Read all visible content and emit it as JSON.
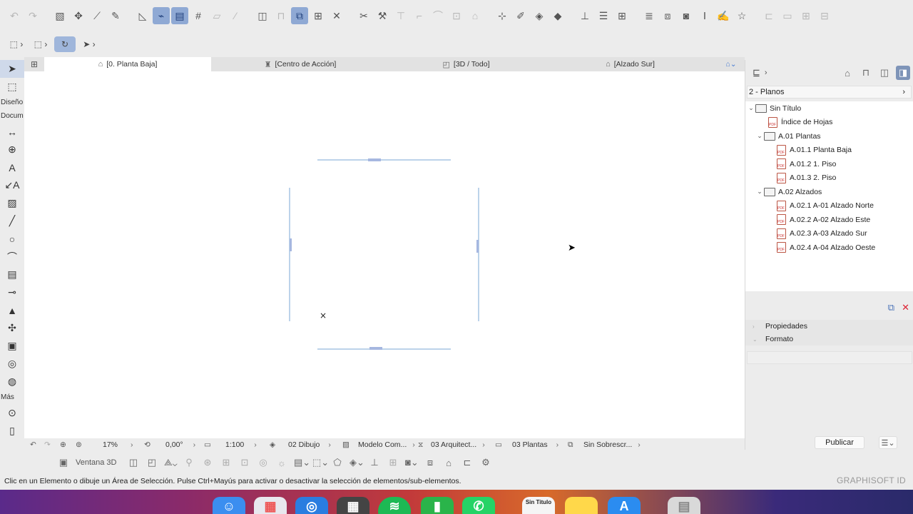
{
  "toolbar": {
    "icons": [
      "undo-icon",
      "redo-icon",
      "pick-up-icon",
      "inject-icon",
      "eyedropper-icon",
      "pencil-icon",
      "ruler-icon",
      "snap-guides-icon",
      "grid-snap-icon",
      "hash-grid-icon",
      "surface-icon",
      "paint-icon",
      "layers-box-icon",
      "lock-icon",
      "trace-icon",
      "renovation-icon",
      "dimension-icon",
      "cross-icon",
      "scissors-icon",
      "hammer-icon",
      "elevate-icon",
      "corner-icon",
      "arc-icon",
      "crop-icon",
      "roof-icon",
      "explode-icon",
      "brush-icon",
      "fill-icon",
      "3d-shape-icon",
      "stair-icon",
      "rail-icon",
      "fence-icon",
      "stack-icon",
      "layers-icon",
      "camera-icon",
      "text-icon",
      "edit-icon",
      "star-icon",
      "beam-icon",
      "column-icon",
      "grid-icon",
      "compare-icon"
    ]
  },
  "toolbar2": {
    "items": [
      "marquee-icon",
      "select-icon",
      "orbit-icon",
      "arrow-pointer-icon"
    ]
  },
  "toolbox": {
    "section_design": "Diseño",
    "section_document": "Docum",
    "section_more": "Más"
  },
  "tabs": [
    {
      "label": "[0. Planta Baja]",
      "icon": "floor-plan-icon"
    },
    {
      "label": "[Centro de Acción]",
      "icon": "action-center-icon"
    },
    {
      "label": "[3D / Todo]",
      "icon": "cube-icon"
    },
    {
      "label": "[Alzado Sur]",
      "icon": "elevation-icon"
    }
  ],
  "canvas": {
    "cursor": "mouse-pointer"
  },
  "viewbar": {
    "zoom": "17%",
    "rotation": "0,00°",
    "scale": "1:100",
    "layer_combination": "02 Dibujo",
    "model_view": "Modelo Com...",
    "pen_set": "03 Arquitect...",
    "plan_type": "03 Plantas",
    "override": "Sin Sobrescr..."
  },
  "toolbar3": {
    "window_3d": "Ventana 3D"
  },
  "status": {
    "message": "Clic en un Elemento o dibuje un Área de Selección. Pulse Ctrl+Mayús para activar o desactivar la selección de elementos/sub-elementos.",
    "brand": "GRAPHISOFT ID"
  },
  "panel": {
    "set_name": "2 - Planos",
    "tree": [
      {
        "label": "Sin Título",
        "level": 0,
        "type": "root",
        "expanded": true
      },
      {
        "label": "Índice de Hojas",
        "level": 1,
        "type": "pdf"
      },
      {
        "label": "A.01 Plantas",
        "level": 1,
        "type": "folder",
        "expanded": true
      },
      {
        "label": "A.01.1 Planta Baja",
        "level": 2,
        "type": "pdf"
      },
      {
        "label": "A.01.2 1. Piso",
        "level": 2,
        "type": "pdf"
      },
      {
        "label": "A.01.3 2. Piso",
        "level": 2,
        "type": "pdf"
      },
      {
        "label": "A.02 Alzados",
        "level": 1,
        "type": "folder",
        "expanded": true
      },
      {
        "label": "A.02.1 A-01 Alzado Norte",
        "level": 2,
        "type": "pdf"
      },
      {
        "label": "A.02.2 A-02 Alzado Este",
        "level": 2,
        "type": "pdf"
      },
      {
        "label": "A.02.3 A-03 Alzado Sur",
        "level": 2,
        "type": "pdf"
      },
      {
        "label": "A.02.4 A-04 Alzado Oeste",
        "level": 2,
        "type": "pdf"
      }
    ],
    "properties_label": "Propiedades",
    "format_label": "Formato",
    "publish_label": "Publicar"
  },
  "dock": {
    "items": [
      "finder-icon",
      "launchpad-icon",
      "safari-icon",
      "calculator-icon",
      "spotify-icon",
      "numbers-icon",
      "whatsapp-icon",
      "archicad-icon",
      "notes-icon",
      "appstore-icon",
      "trash-icon"
    ],
    "archicad_label": "Sin Titulo"
  },
  "colors": {
    "accent": "#8fa9d4",
    "canvas_line": "#7aa7d6",
    "panel_bg": "#ececec"
  }
}
